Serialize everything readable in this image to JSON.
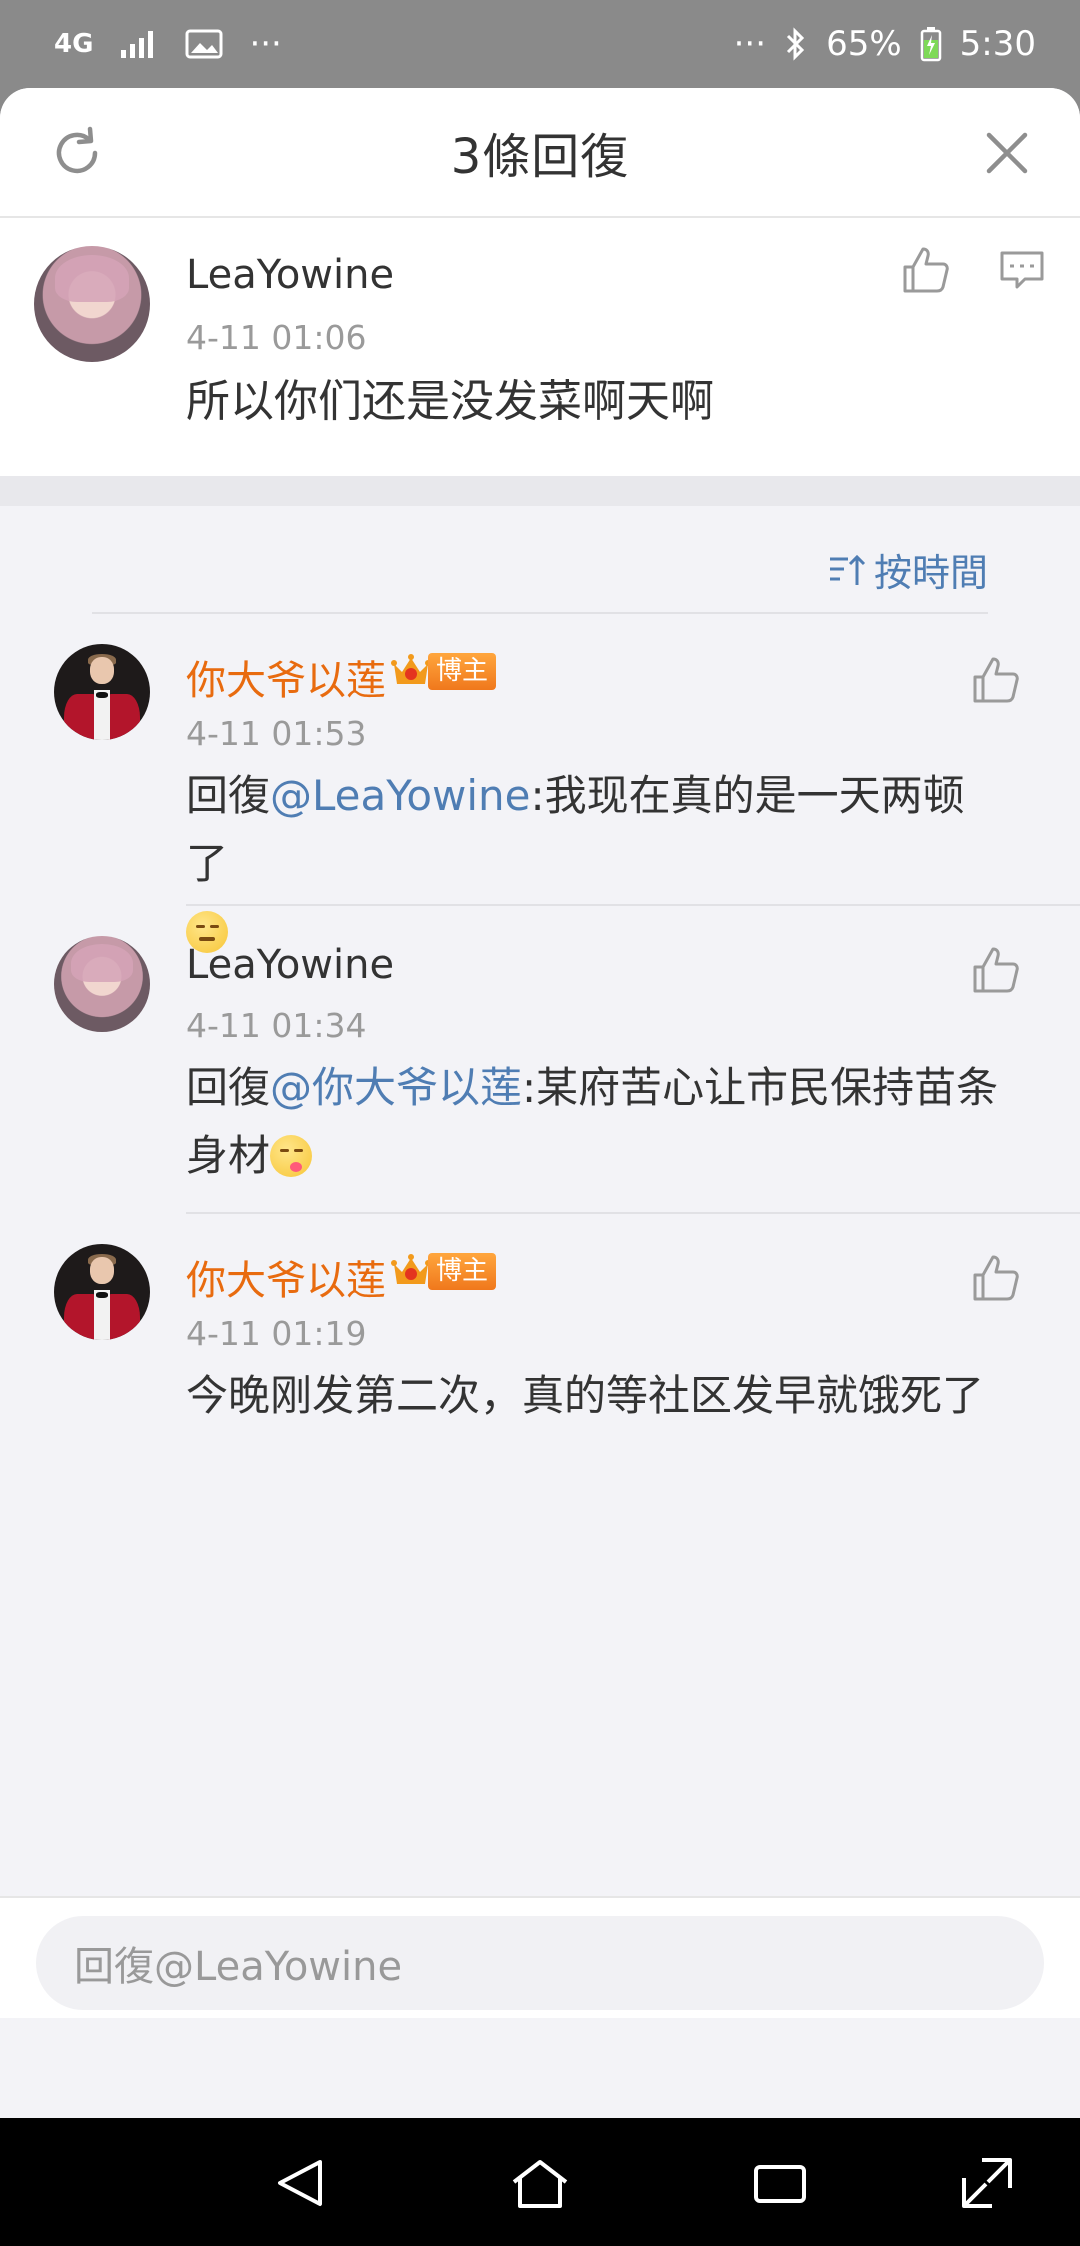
{
  "status_bar": {
    "network": "4G",
    "more": "···",
    "more_right": "···",
    "battery": "65%",
    "time": "5:30"
  },
  "header": {
    "title": "3條回復"
  },
  "main_comment": {
    "author": "LeaYowine",
    "time": "4-11 01:06",
    "text": "所以你们还是没发菜啊天啊"
  },
  "sort": {
    "label": "按時間"
  },
  "replies": [
    {
      "author": "你大爷以莲",
      "badge": "博主",
      "time": "4-11 01:53",
      "prefix": "回復",
      "mention": "@LeaYowine",
      "text": ":我现在真的是一天两顿了"
    },
    {
      "author": "LeaYowine",
      "time": "4-11 01:34",
      "prefix": "回復",
      "mention": "@你大爷以莲",
      "text_line1": ":某府苦心让市民保持苗条",
      "text_line2": "身材"
    },
    {
      "author": "你大爷以莲",
      "badge": "博主",
      "time": "4-11 01:19",
      "text": "今晚刚发第二次，真的等社区发早就饿死了"
    }
  ],
  "input": {
    "placeholder": "回復@LeaYowine"
  },
  "colors": {
    "accent_blue": "#4f7db3",
    "vip_orange": "#e86b0f",
    "badge_orange": "#f0781c"
  }
}
